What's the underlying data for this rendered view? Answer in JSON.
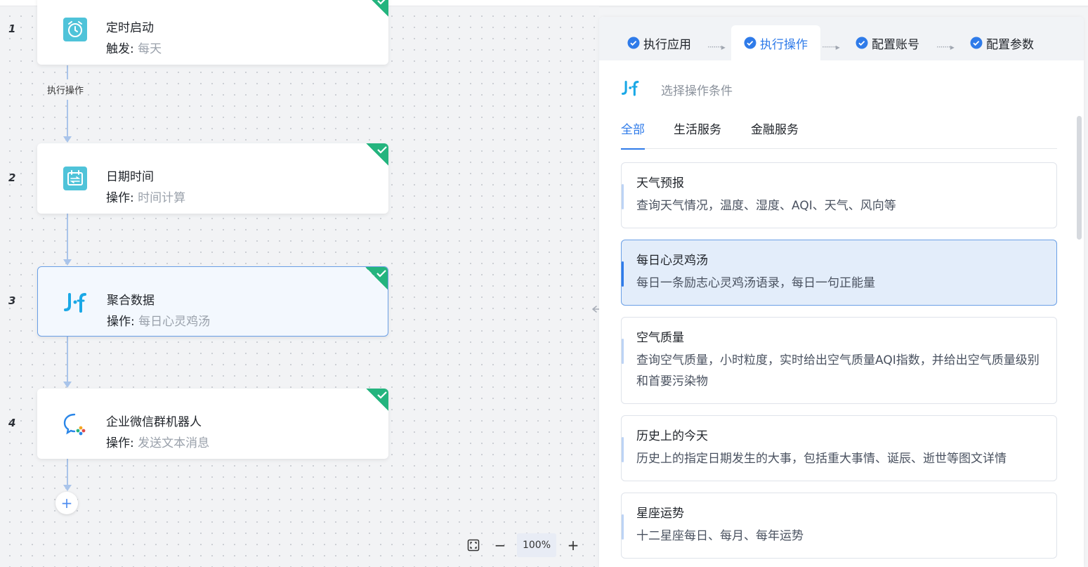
{
  "workflow": {
    "nodes": [
      {
        "step": "1",
        "title": "定时启动",
        "sub_label": "触发:",
        "sub_value": "每天",
        "icon": "alarm-clock-icon",
        "done": true
      },
      {
        "step": "2",
        "title": "日期时间",
        "sub_label": "操作:",
        "sub_value": "时间计算",
        "icon": "calendar-icon",
        "done": true
      },
      {
        "step": "3",
        "title": "聚合数据",
        "sub_label": "操作:",
        "sub_value": "每日心灵鸡汤",
        "icon": "juhe-logo-icon",
        "done": true
      },
      {
        "step": "4",
        "title": "企业微信群机器人",
        "sub_label": "操作:",
        "sub_value": "发送文本消息",
        "icon": "wecom-icon",
        "done": true
      }
    ],
    "edge_label": "执行操作",
    "add_symbol": "+"
  },
  "zoom": {
    "minus": "−",
    "value": "100%",
    "plus": "+"
  },
  "panel": {
    "steps": [
      {
        "label": "执行应用"
      },
      {
        "label": "执行操作"
      },
      {
        "label": "配置账号"
      },
      {
        "label": "配置参数"
      }
    ],
    "step_separator": "·······▸",
    "app_hint": "选择操作条件",
    "categories": [
      "全部",
      "生活服务",
      "金融服务"
    ],
    "operations": [
      {
        "name": "天气预报",
        "desc": "查询天气情况，温度、湿度、AQI、天气、风向等"
      },
      {
        "name": "每日心灵鸡汤",
        "desc": "每日一条励志心灵鸡汤语录，每日一句正能量"
      },
      {
        "name": "空气质量",
        "desc": "查询空气质量，小时粒度，实时给出空气质量AQI指数，并给出空气质量级别和首要污染物"
      },
      {
        "name": "历史上的今天",
        "desc": "历史上的指定日期发生的大事，包括重大事情、诞辰、逝世等图文详情"
      },
      {
        "name": "星座运势",
        "desc": "十二星座每日、每月、每年运势"
      }
    ]
  },
  "colors": {
    "accent": "#2f7be9",
    "success": "#24b47e",
    "teal": "#4fc3d9"
  }
}
